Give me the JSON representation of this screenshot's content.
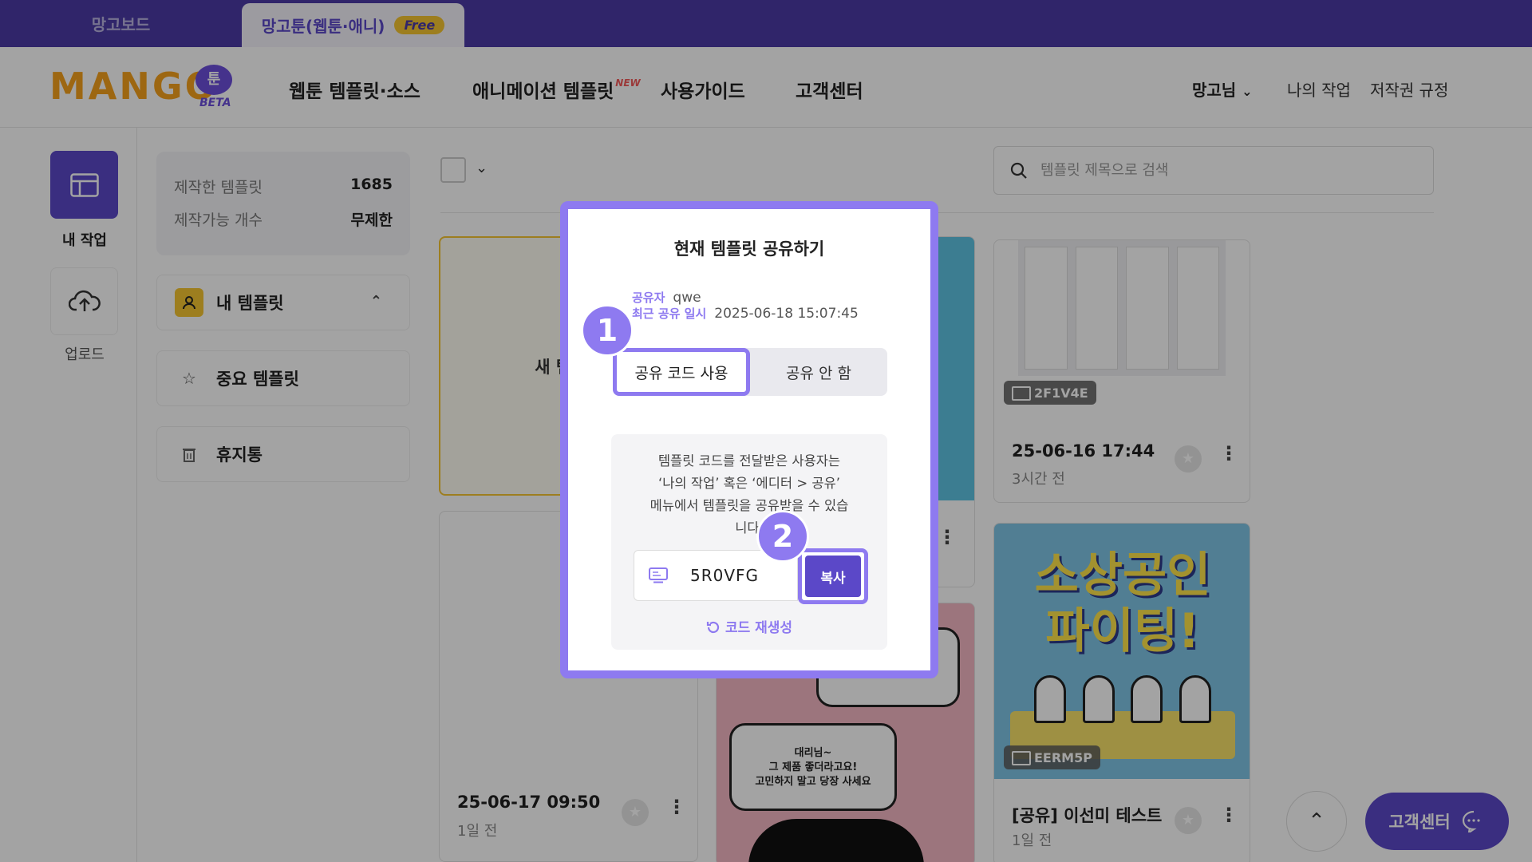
{
  "top_tabs": {
    "dashboard": "망고보드",
    "toon": "망고툰(웹툰·애니)",
    "free_badge": "Free"
  },
  "header": {
    "logo": "MANGO",
    "logo_badge": "툰",
    "logo_beta": "BETA",
    "nav": {
      "webtoon": "웹툰 템플릿·소스",
      "animation": "애니메이션 템플릿",
      "animation_badge": "NEW",
      "guide": "사용가이드",
      "support": "고객센터"
    },
    "user": "망고님",
    "my_work": "나의 작업",
    "copyright": "저작권 규정"
  },
  "rail": {
    "my_work": "내 작업",
    "upload": "업로드"
  },
  "stats": {
    "made_label": "제작한 템플릿",
    "made_value": "1685",
    "capacity_label": "제작가능 개수",
    "capacity_value": "무제한"
  },
  "side_menu": {
    "my_templates": "내 템플릿",
    "important": "중요 템플릿",
    "trash": "휴지통"
  },
  "search": {
    "placeholder": "템플릿 제목으로 검색"
  },
  "cards": {
    "new": "새 템플릿",
    "blank": {
      "date": "25-06-17 09:50",
      "ago": "1일 전"
    },
    "c3": {
      "code": "2F1V4E",
      "date": "25-06-16 17:44",
      "ago": "3시간 전"
    },
    "c4": {
      "code": "EERM5P",
      "title": "[공유] 이선미 테스트",
      "ago": "1일 전",
      "poster": "소상공인\n파이팅!"
    },
    "c2b": {
      "speech": "대리님~\n그 제품 좋더라고요!\n고민하지 말고 당장 사세요"
    }
  },
  "modal": {
    "title": "현재 템플릿 공유하기",
    "sharer_label": "공유자",
    "sharer_value": "qwe",
    "last_shared_label": "최근 공유 일시",
    "last_shared_value": "2025-06-18 15:07:45",
    "option_use": "공유 코드 사용",
    "option_none": "공유 안 함",
    "info": "템플릿 코드를 전달받은 사용자는\n‘나의 작업’ 혹은 ‘에디터 > 공유’\n메뉴에서 템플릿을 공유받을 수 있습\n니다.",
    "code": "5R0VFG",
    "copy": "복사",
    "regenerate": "코드 재생성"
  },
  "steps": {
    "one": "1",
    "two": "2"
  },
  "floating": {
    "help": "고객센터"
  },
  "colors": {
    "primary": "#5b48c8",
    "accent": "#8e7af0",
    "logo": "#f6a21d",
    "badge": "#f6c531"
  }
}
